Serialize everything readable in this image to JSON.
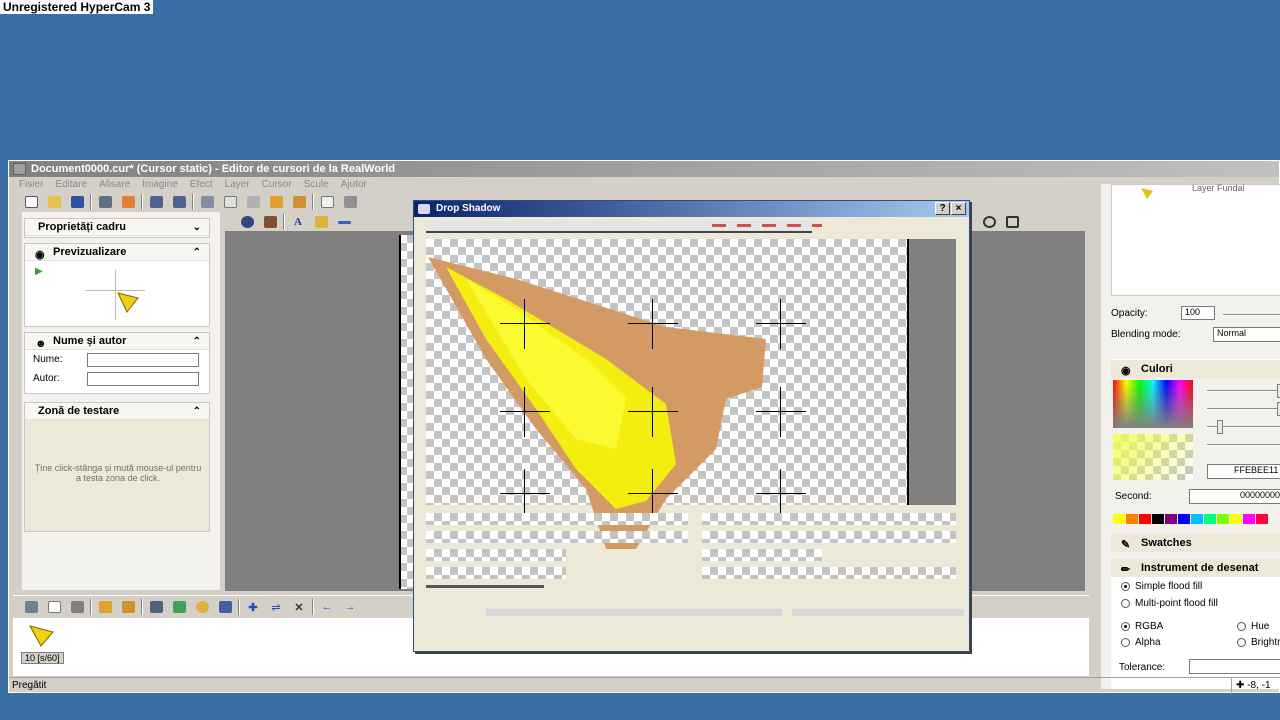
{
  "watermark": "Unregistered HyperCam 3",
  "window": {
    "title": "Document0000.cur* (Cursor static) - Editor de cursori de la RealWorld"
  },
  "menu": [
    "Fisier",
    "Editare",
    "Afisare",
    "Imagine",
    "Efect",
    "Layer",
    "Cursor",
    "Scule",
    "Ajutor"
  ],
  "left_panels": {
    "frame_props": "Proprietăți cadru",
    "preview": "Previzualizare",
    "name_author": "Nume și autor",
    "name_label": "Nume:",
    "author_label": "Autor:",
    "test_zone": "Zonă de testare",
    "test_hint": "Ține click-stânga și mută mouse-ul pentru a testa zona de click."
  },
  "frame_strip": {
    "frame_label": "10 [s/60]"
  },
  "dialog": {
    "title": "Drop Shadow",
    "help_btn": "?",
    "close_btn": "×"
  },
  "right_panel": {
    "layer_name": "Layer Fundal",
    "opacity_label": "Opacity:",
    "opacity_value": "100",
    "blending_label": "Blending mode:",
    "blending_value": "Normal",
    "colors_title": "Culori",
    "primary_hex": "FFEBEE11",
    "second_label": "Second:",
    "second_hex": "00000000",
    "swatches_title": "Swatches",
    "swatch_colors": [
      "#ffff00",
      "#ff8000",
      "#ff0000",
      "#000000",
      "#800080",
      "#0000ff",
      "#00c0ff",
      "#00ff80",
      "#80ff00",
      "#ffff00",
      "#ff00ff",
      "#ff0040"
    ],
    "tool_title": "Instrument de desenat",
    "simple_fill": "Simple flood fill",
    "multi_fill": "Multi-point flood fill",
    "rgba": "RGBA",
    "hue": "Hue",
    "alpha": "Alpha",
    "brightness": "Brightr",
    "tolerance_label": "Tolerance:"
  },
  "status": {
    "text": "Pregătit",
    "coords": "-8, -1"
  }
}
